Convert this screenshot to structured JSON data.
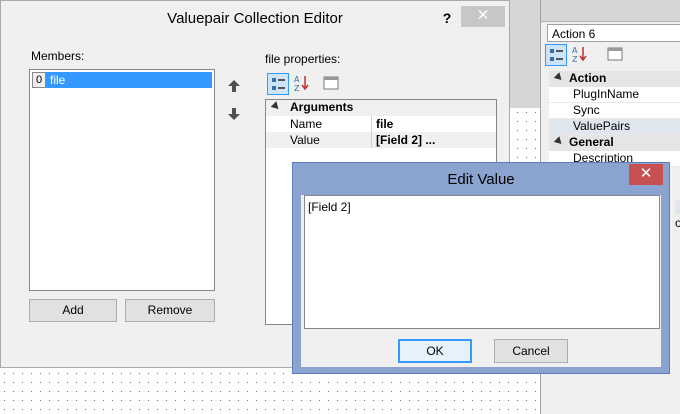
{
  "main_dialog": {
    "title": "Valuepair Collection Editor",
    "help_label": "?",
    "close_label": "✕",
    "members_label": "Members:",
    "members": [
      {
        "index": "0",
        "name": "file"
      }
    ],
    "add_label": "Add",
    "remove_label": "Remove",
    "file_properties_label": "file properties:",
    "arguments": {
      "category": "Arguments",
      "rows": [
        {
          "name": "Name",
          "value": "file"
        },
        {
          "name": "Value",
          "value": "[Field 2] ..."
        }
      ]
    }
  },
  "edit_value_dialog": {
    "title": "Edit Value",
    "close_label": "✕",
    "value": "[Field 2]",
    "ok_label": "OK",
    "cancel_label": "Cancel"
  },
  "right_panel": {
    "header": "Action 6",
    "categories": [
      {
        "name": "Action",
        "items": [
          "PlugInName",
          "Sync",
          "ValuePairs"
        ]
      },
      {
        "name": "General",
        "items": [
          "Description"
        ]
      }
    ],
    "partial_text": "o"
  },
  "colors": {
    "selection_blue": "#3399ff",
    "edit_title_bar": "#8aa4cf",
    "close_red": "#c75050"
  }
}
